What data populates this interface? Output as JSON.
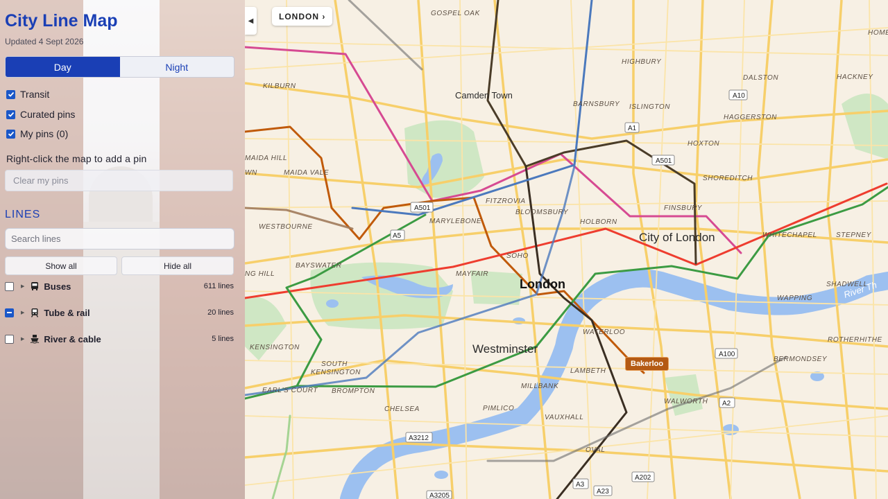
{
  "app": {
    "title": "City Line Map",
    "updated": "Updated 4 Sept 2026"
  },
  "mode_toggle": {
    "day": "Day",
    "night": "Night",
    "selected": "Day"
  },
  "layers": [
    {
      "label": "Transit",
      "checked": true
    },
    {
      "label": "Curated pins",
      "checked": true
    },
    {
      "label": "My pins (0)",
      "checked": true
    }
  ],
  "pins": {
    "hint": "Right-click the map to add a pin",
    "clear_label": "Clear my pins"
  },
  "lines_panel": {
    "heading": "LINES",
    "search_placeholder": "Search lines",
    "show_all": "Show all",
    "hide_all": "Hide all",
    "groups": [
      {
        "name": "Buses",
        "count": "611 lines",
        "icon": "bus-icon",
        "state": "unchecked"
      },
      {
        "name": "Tube & rail",
        "count": "20 lines",
        "icon": "train-icon",
        "state": "indeterminate"
      },
      {
        "name": "River & cable",
        "count": "5 lines",
        "icon": "boat-icon",
        "state": "unchecked"
      }
    ]
  },
  "map": {
    "breadcrumb": "LONDON ›",
    "collapse_icon": "◀",
    "highlight_line": "Bakerloo",
    "places": {
      "gospel_oak": "GOSPEL OAK",
      "homerton": "HOMERT",
      "highbury": "HIGHBURY",
      "dalston": "DALSTON",
      "hackney": "HACKNEY",
      "kilburn": "KILBURN",
      "camden": "Camden Town",
      "barnsbury": "BARNSBURY",
      "islington": "ISLINGTON",
      "haggerston": "HAGGERSTON",
      "hoxton": "HOXTON",
      "maida_hill": "MAIDA HILL",
      "maida_vale": "MAIDA VALE",
      "wn": "WN",
      "shoreditch": "SHOREDITCH",
      "fitzrovia": "FITZROVIA",
      "bloomsbury": "BLOOMSBURY",
      "finsbury": "FINSBURY",
      "westbourne": "WESTBOURNE",
      "marylebone": "MARYLEBONE",
      "holborn": "HOLBORN",
      "city": "City of London",
      "whitechapel": "WHITECHAPEL",
      "stepney": "STEPNEY",
      "soho": "SOHO",
      "bayswater": "BAYSWATER",
      "ng_hill": "NG HILL",
      "mayfair": "MAYFAIR",
      "london": "London",
      "shadwell": "SHADWELL",
      "wapping": "WAPPING",
      "kensington": "KENSINGTON",
      "westminster": "Westminster",
      "waterloo": "WATERLOO",
      "rotherhithe": "ROTHERHITHE",
      "south_kensington_1": "SOUTH",
      "south_kensington_2": "KENSINGTON",
      "lambeth": "LAMBETH",
      "bermondsey": "BERMONDSEY",
      "earls_court": "EARL'S COURT",
      "brompton": "BROMPTON",
      "millbank": "MILLBANK",
      "chelsea": "CHELSEA",
      "pimlico": "PIMLICO",
      "vauxhall": "VAUXHALL",
      "walworth": "WALWORTH",
      "oval": "OVAL",
      "river_thames": "River Th"
    },
    "roads": {
      "a10": "A10",
      "a1": "A1",
      "a501_e": "A501",
      "a501_w": "A501",
      "a5": "A5",
      "a100": "A100",
      "a2": "A2",
      "a3212": "A3212",
      "a202": "A202",
      "a3": "A3",
      "a23": "A23",
      "a3205": "A3205"
    }
  }
}
